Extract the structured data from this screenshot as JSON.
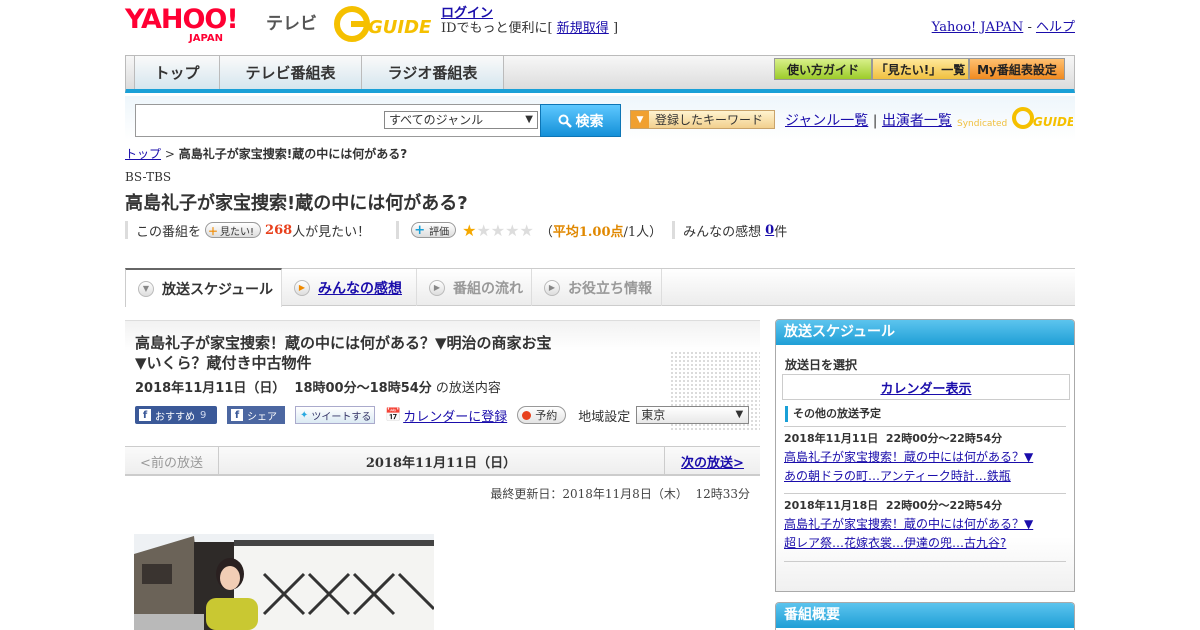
{
  "header": {
    "yahoo_logo": "YAHOO!",
    "yahoo_sub": "JAPAN",
    "tv_label": "テレビ",
    "gguide_logo": "G GUIDE",
    "login_link": "ログイン",
    "login_text": "IDでもっと便利に[",
    "register_link": "新規取得",
    "login_close": "]",
    "yahoo_japan_link": "Yahoo! JAPAN",
    "separator": "-",
    "help_link": "ヘルプ"
  },
  "nav": {
    "tabs": [
      "トップ",
      "テレビ番組表",
      "ラジオ番組表"
    ],
    "buttons": [
      "使い方ガイド",
      "「見たい!」一覧",
      "My番組表設定"
    ]
  },
  "search": {
    "genre_selected": "すべてのジャンル",
    "search_button": "検索",
    "keyword_button": "登録したキーワード",
    "genre_list_link": "ジャンル一覧",
    "pipe": "|",
    "cast_list_link": "出演者一覧",
    "syndicated": "Syndicated"
  },
  "breadcrumb": {
    "top_link": "トップ",
    "sep": ">",
    "current": "高島礼子が家宝捜索!蔵の中には何がある?"
  },
  "program": {
    "channel": "BS-TBS",
    "title": "高島礼子が家宝捜索!蔵の中には何がある?",
    "want_prefix": "この番組を",
    "want_button": "見たい!",
    "want_count": "268",
    "want_suffix": "人が見たい！",
    "rate_button": "評価",
    "rating_stars": 1,
    "rating_open": "（",
    "rating_avg": "平均1.00点",
    "rating_people": "/1人）",
    "impressions_label": "みんなの感想",
    "impressions_count": "0",
    "impressions_unit": "件"
  },
  "subtabs": [
    "放送スケジュール",
    "みんなの感想",
    "番組の流れ",
    "お役立ち情報"
  ],
  "article": {
    "title_line1": "高島礼子が家宝捜索！蔵の中には何がある？▼明治の商家お宝",
    "title_line2": "▼いくら？蔵付き中古物件",
    "date": "2018年11月11日（日）  18時00分～18時54分",
    "date_suffix": "の放送内容",
    "share_recommend": "おすすめ",
    "share_recommend_count": "9",
    "share_fb": "シェア",
    "share_tweet": "ツイートする",
    "calendar_register": "カレンダーに登録",
    "reserve": "予約",
    "region_label": "地域設定",
    "region_value": "東京"
  },
  "pager": {
    "prev": "<前の放送",
    "date": "2018年11月11日（日）",
    "next": "次の放送>"
  },
  "updated": "最終更新日：2018年11月8日（木）  12時33分",
  "sidebar": {
    "schedule_header": "放送スケジュール",
    "select_label": "放送日を選択",
    "calendar_button": "カレンダー表示",
    "other_label": "その他の放送予定",
    "other_items": [
      {
        "date": "2018年11月11日  22時00分～22時54分",
        "line1": "高島礼子が家宝捜索！蔵の中には何がある？▼",
        "line2": "あの朝ドラの町…アンティーク時計…鉄瓶"
      },
      {
        "date": "2018年11月18日  22時00分～22時54分",
        "line1": "高島礼子が家宝捜索！蔵の中には何がある？▼",
        "line2": "超レア祭…花嫁衣裳…伊達の兜…古九谷?"
      }
    ],
    "overview_header": "番組概要"
  },
  "colors": {
    "accent_blue": "#19a0d7",
    "yahoo_red": "#ff0033",
    "link": "#1a0dab",
    "want_red": "#e8401c",
    "star": "#f5a800"
  }
}
